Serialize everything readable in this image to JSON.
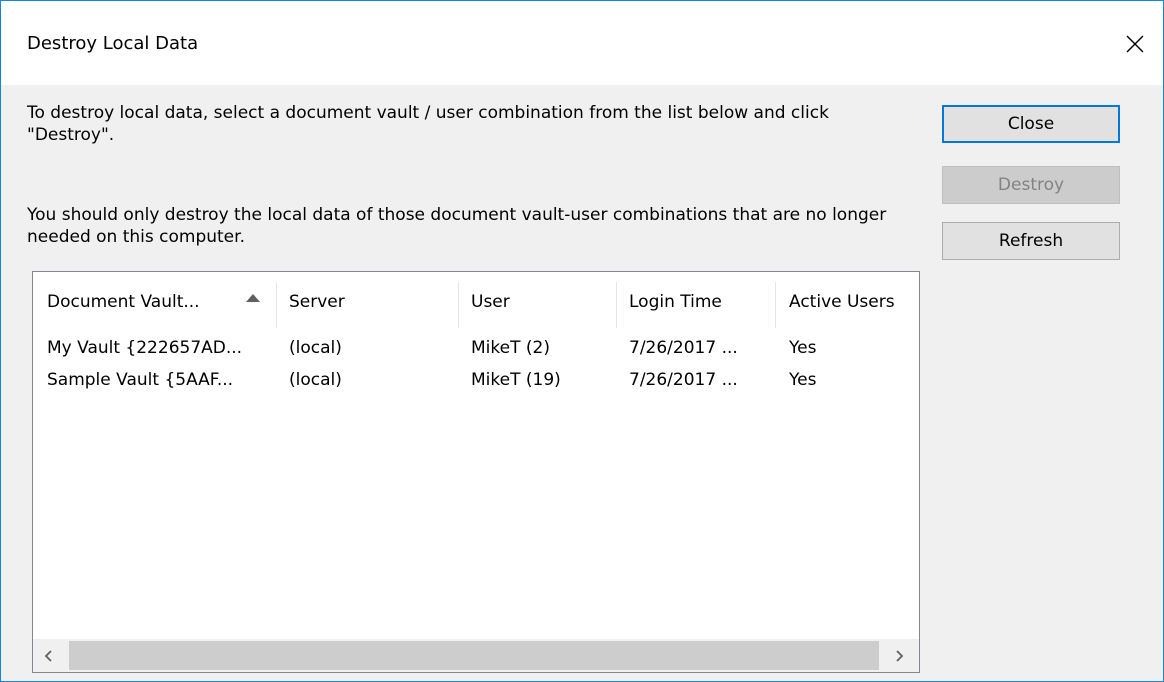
{
  "window": {
    "title": "Destroy Local Data"
  },
  "instructions": {
    "line1": "To destroy local data, select a document vault / user combination from the list below and click \"Destroy\".",
    "line2": "You should only destroy the local data of those document vault-user combinations that are no longer needed on this computer."
  },
  "buttons": {
    "close": "Close",
    "destroy": "Destroy",
    "refresh": "Refresh"
  },
  "list": {
    "columns": [
      "Document Vault...",
      "Server",
      "User",
      "Login Time",
      "Active Users"
    ],
    "sort": {
      "column": "Document Vault...",
      "direction": "ascending"
    },
    "rows": [
      [
        "My Vault {222657AD...",
        "(local)",
        "MikeT (2)",
        "7/26/2017 ...",
        "Yes"
      ],
      [
        "Sample Vault {5AAF...",
        "(local)",
        "MikeT (19)",
        "7/26/2017 ...",
        "Yes"
      ]
    ]
  },
  "icons": {
    "title_close": "close-icon",
    "sort": "sort-ascending-icon",
    "scroll_left": "scroll-left-icon",
    "scroll_right": "scroll-right-icon"
  },
  "colors": {
    "window_border": "#1883d7",
    "default_button_border": "#0078d7",
    "disabled_text": "#838383"
  }
}
